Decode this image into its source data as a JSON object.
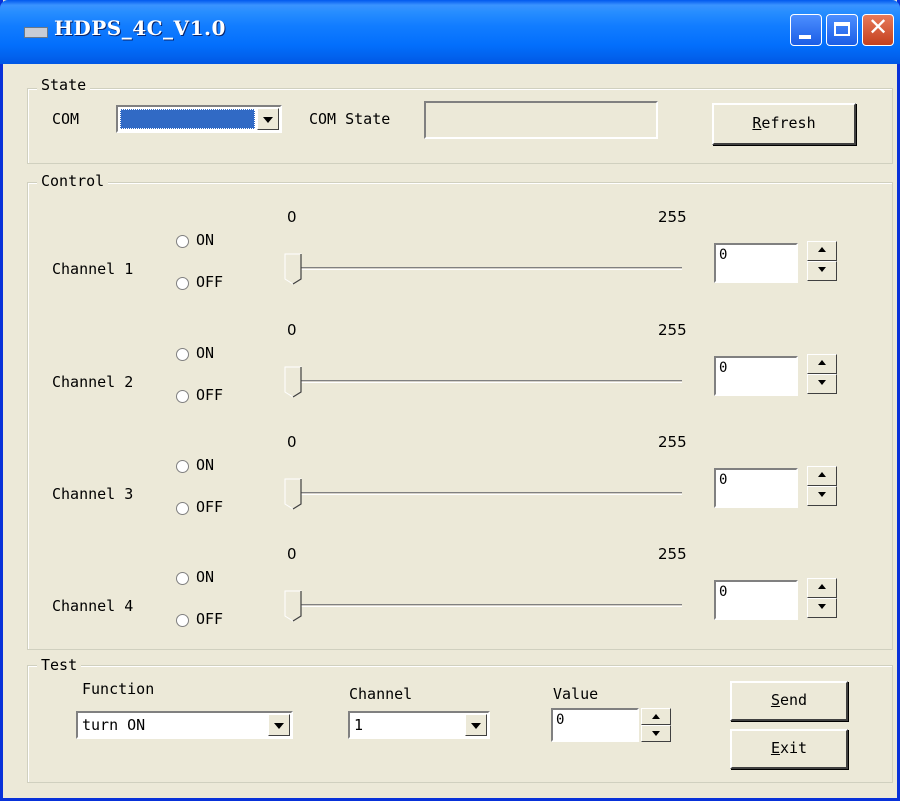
{
  "window": {
    "title": "HDPS_4C_V1.0"
  },
  "state": {
    "legend": "State",
    "com_label": "COM",
    "com_value": "",
    "com_state_label": "COM State",
    "com_state_value": "",
    "refresh_label": "Refresh",
    "refresh_underline": "R",
    "refresh_rest": "efresh"
  },
  "control": {
    "legend": "Control",
    "channels": [
      {
        "label": "Channel 1",
        "on": "ON",
        "off": "OFF",
        "min": "0",
        "max": "255",
        "value": "0",
        "slider_value": 0
      },
      {
        "label": "Channel 2",
        "on": "ON",
        "off": "OFF",
        "min": "0",
        "max": "255",
        "value": "0",
        "slider_value": 0
      },
      {
        "label": "Channel 3",
        "on": "ON",
        "off": "OFF",
        "min": "0",
        "max": "255",
        "value": "0",
        "slider_value": 0
      },
      {
        "label": "Channel 4",
        "on": "ON",
        "off": "OFF",
        "min": "0",
        "max": "255",
        "value": "0",
        "slider_value": 0
      }
    ]
  },
  "test": {
    "legend": "Test",
    "function_label": "Function",
    "function_value": "turn ON",
    "channel_label": "Channel",
    "channel_value": "1",
    "value_label": "Value",
    "value_value": "0",
    "send_underline": "S",
    "send_rest": "end",
    "exit_underline": "E",
    "exit_rest": "xit"
  }
}
